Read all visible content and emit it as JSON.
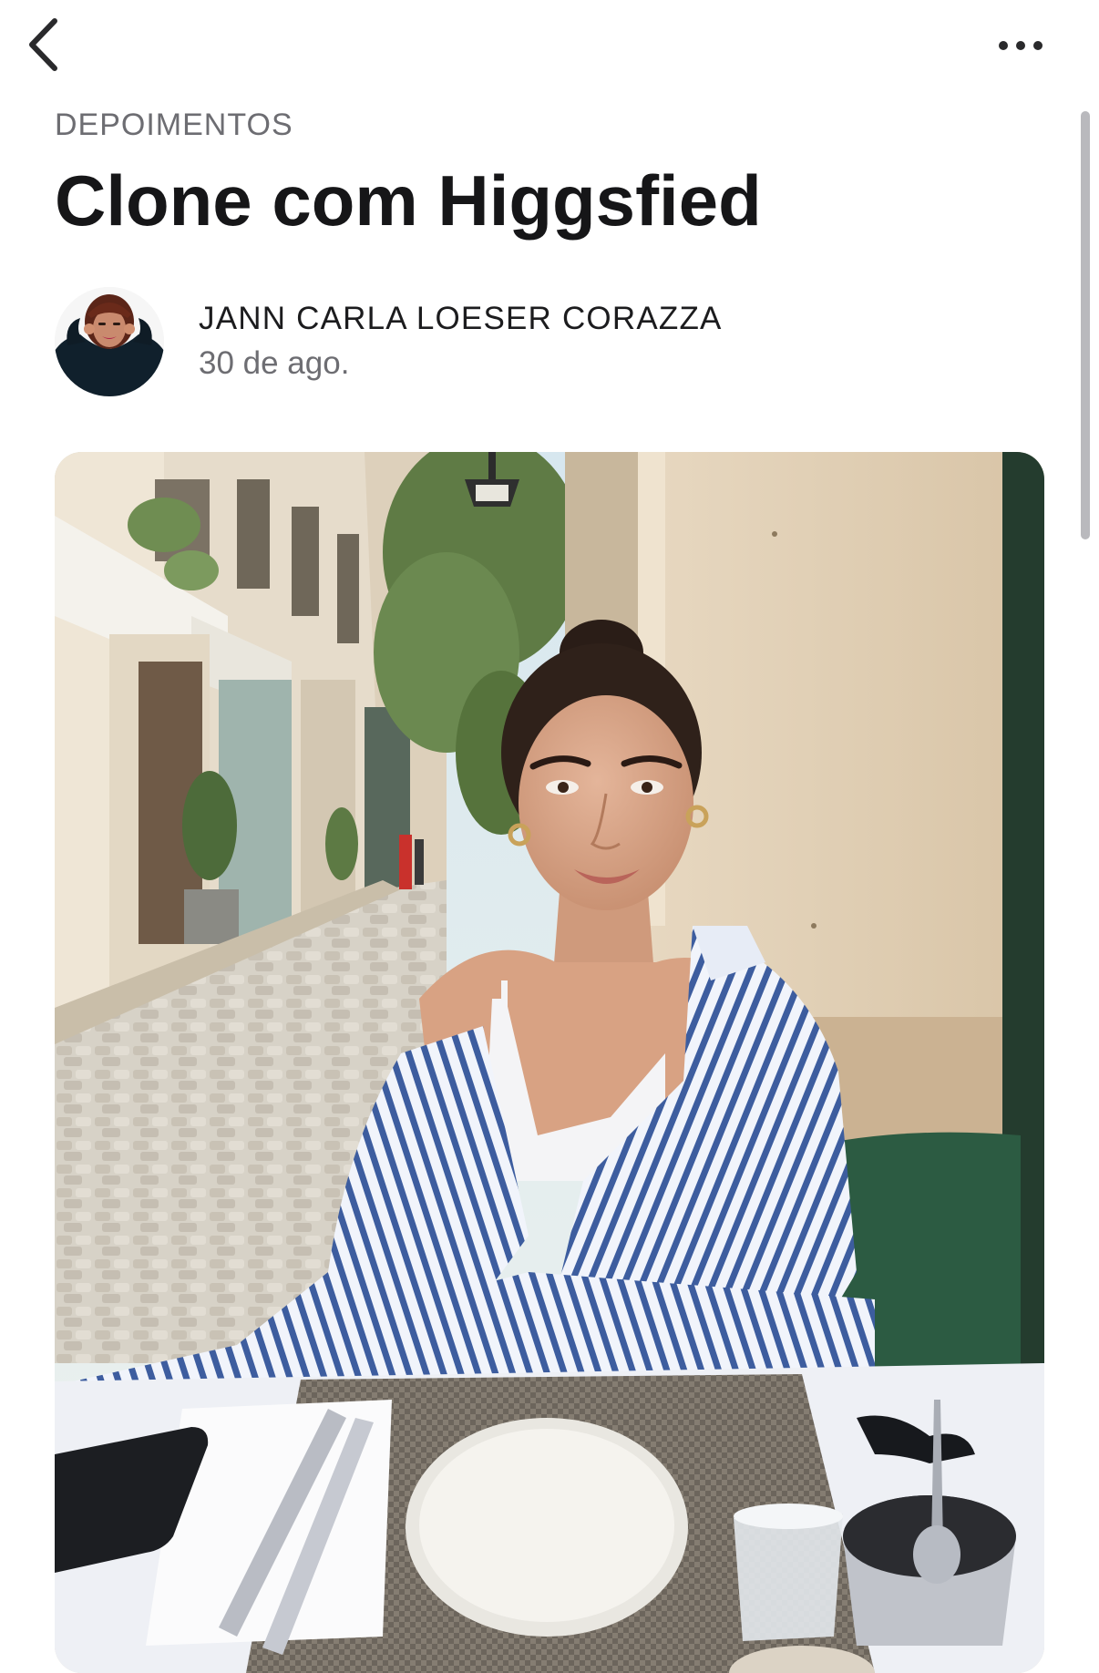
{
  "nav": {
    "back_icon": "chevron-left-icon",
    "more_icon": "ellipsis-horizontal-icon"
  },
  "post": {
    "category": "DEPOIMENTOS",
    "title": "Clone com Higgsfied",
    "author": {
      "name": "JANN CARLA LOESER CORAZZA",
      "date": "30 de ago."
    }
  },
  "colors": {
    "text_primary": "#161618",
    "text_secondary": "#6d6d72",
    "background": "#ffffff"
  }
}
